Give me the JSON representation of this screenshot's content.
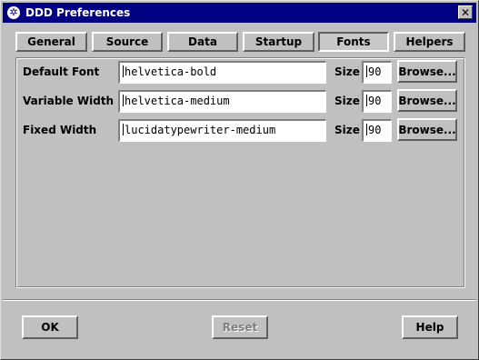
{
  "window": {
    "title": "DDD Preferences",
    "close_label": "✕",
    "title_icon": "ddd-icon"
  },
  "tabs": [
    {
      "label": "General",
      "active": false
    },
    {
      "label": "Source",
      "active": false
    },
    {
      "label": "Data",
      "active": false
    },
    {
      "label": "Startup",
      "active": false
    },
    {
      "label": "Fonts",
      "active": true
    },
    {
      "label": "Helpers",
      "active": false
    }
  ],
  "fonts": {
    "size_label": "Size",
    "browse_label": "Browse...",
    "rows": [
      {
        "label": "Default Font",
        "value": "helvetica-bold",
        "size": "90"
      },
      {
        "label": "Variable Width",
        "value": "helvetica-medium",
        "size": "90"
      },
      {
        "label": "Fixed Width",
        "value": "lucidatypewriter-medium",
        "size": "90"
      }
    ]
  },
  "buttons": {
    "ok": "OK",
    "reset": "Reset",
    "help": "Help"
  }
}
